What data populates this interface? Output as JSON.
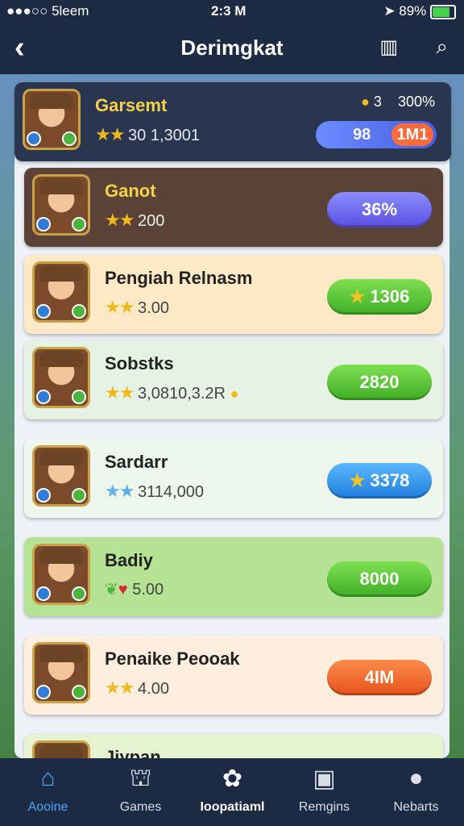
{
  "status": {
    "carrier": "●●●○○ 5leem",
    "time": "2:3 M",
    "battery": "89%",
    "battery_fraction": 0.89
  },
  "header": {
    "title": "Derimgkat"
  },
  "top_card": {
    "name": "Garsemt",
    "stats": "30 1,3001",
    "coin_value": "3",
    "percent": "300%",
    "progress_left": "98",
    "progress_right": "1M1"
  },
  "cards": [
    {
      "name": "Ganot",
      "stats": "200",
      "button": "36%",
      "style": "purple",
      "bg": "#5a4336",
      "name_color": "#f4d24a",
      "stat_color": "#eee"
    },
    {
      "name": "Pengiah Relnasm",
      "stats": "3.00",
      "button": "1306",
      "style": "green",
      "bg": "#fde9c6"
    },
    {
      "name": "Sobstks",
      "stats": "3,0810,3.2R",
      "button": "2820",
      "style": "green",
      "bg": "#e6f3e4"
    },
    {
      "name": "Sardarr",
      "stats": "3114,000",
      "button": "3378",
      "style": "blue",
      "bg": "#eef7ee"
    },
    {
      "name": "Badiy",
      "stats": "5.00",
      "button": "8000",
      "style": "green",
      "bg": "#b6e294"
    },
    {
      "name": "Penaike Peooak",
      "stats": "4.00",
      "button": "4IM",
      "style": "orange",
      "bg": "#fdeede"
    },
    {
      "name": "Jiypan",
      "stats": "",
      "button": "",
      "style": "orange",
      "bg": "#e6f3d0"
    }
  ],
  "tabs": [
    {
      "label": "Aooine",
      "icon": "home-icon"
    },
    {
      "label": "Games",
      "icon": "store-icon"
    },
    {
      "label": "Ioopatiaml",
      "icon": "gamepad-icon"
    },
    {
      "label": "Remgins",
      "icon": "rewards-icon"
    },
    {
      "label": "Nebarts",
      "icon": "profile-icon"
    }
  ]
}
